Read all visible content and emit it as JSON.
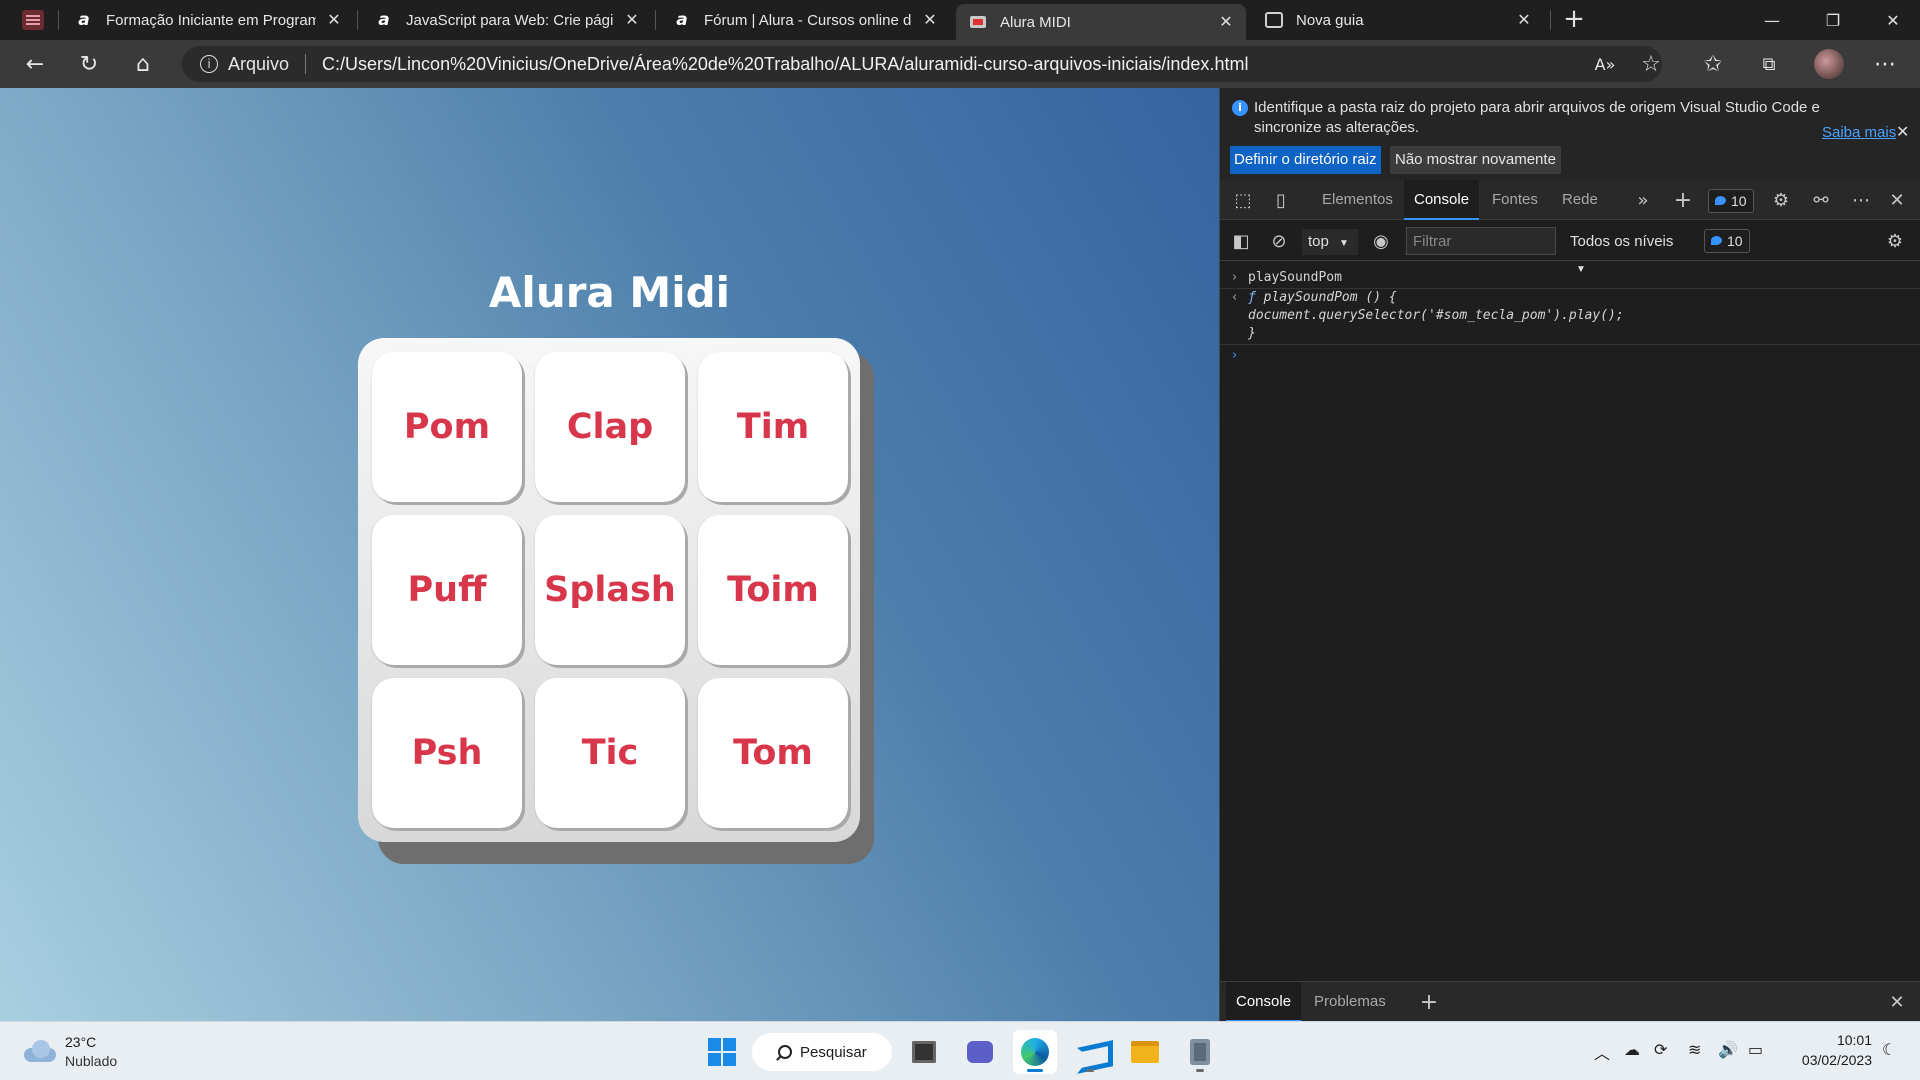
{
  "browser": {
    "tabs": [
      {
        "title": "Formação Iniciante em Programa",
        "close": "✕"
      },
      {
        "title": "JavaScript para Web: Crie página",
        "close": "✕"
      },
      {
        "title": "Fórum | Alura - Cursos online de",
        "close": "✕"
      },
      {
        "title": "Alura MIDI",
        "close": "✕"
      },
      {
        "title": "Nova guia",
        "close": "✕"
      }
    ],
    "favicon_letter": "a",
    "address": {
      "security_label": "Arquivo",
      "url": "C:/Users/Lincon%20Vinicius/OneDrive/Área%20de%20Trabalho/ALURA/aluramidi-curso-arquivos-iniciais/index.html"
    }
  },
  "page": {
    "title": "Alura Midi",
    "keys": [
      "Pom",
      "Clap",
      "Tim",
      "Puff",
      "Splash",
      "Toim",
      "Psh",
      "Tic",
      "Tom"
    ]
  },
  "devtools": {
    "infobar": {
      "message": "Identifique a pasta raiz do projeto para abrir arquivos de origem Visual Studio Code e sincronize as alterações.",
      "learn_more": "Saiba mais",
      "primary_button": "Definir o diretório raiz",
      "secondary_button": "Não mostrar novamente"
    },
    "tabs": [
      "Elementos",
      "Console",
      "Fontes",
      "Rede"
    ],
    "active_tab": "Console",
    "message_count": "10",
    "context": "top",
    "filter_placeholder": "Filtrar",
    "levels": "Todos os níveis",
    "filter_count": "10",
    "console": {
      "input": "playSoundPom",
      "output_keyword": "ƒ",
      "output_line1": " playSoundPom () {",
      "output_line2": "document.querySelector('#som_tecla_pom').play();",
      "output_line3": "}"
    },
    "drawer_tabs": [
      "Console",
      "Problemas"
    ]
  },
  "taskbar": {
    "weather": {
      "temp": "23°C",
      "desc": "Nublado"
    },
    "search_label": "Pesquisar",
    "clock": {
      "time": "10:01",
      "date": "03/02/2023"
    }
  },
  "icons": {
    "back": "back-arrow-icon",
    "refresh": "refresh-icon",
    "home": "home-icon",
    "accent": "#3794ff",
    "key_text_color": "#d8364a"
  }
}
